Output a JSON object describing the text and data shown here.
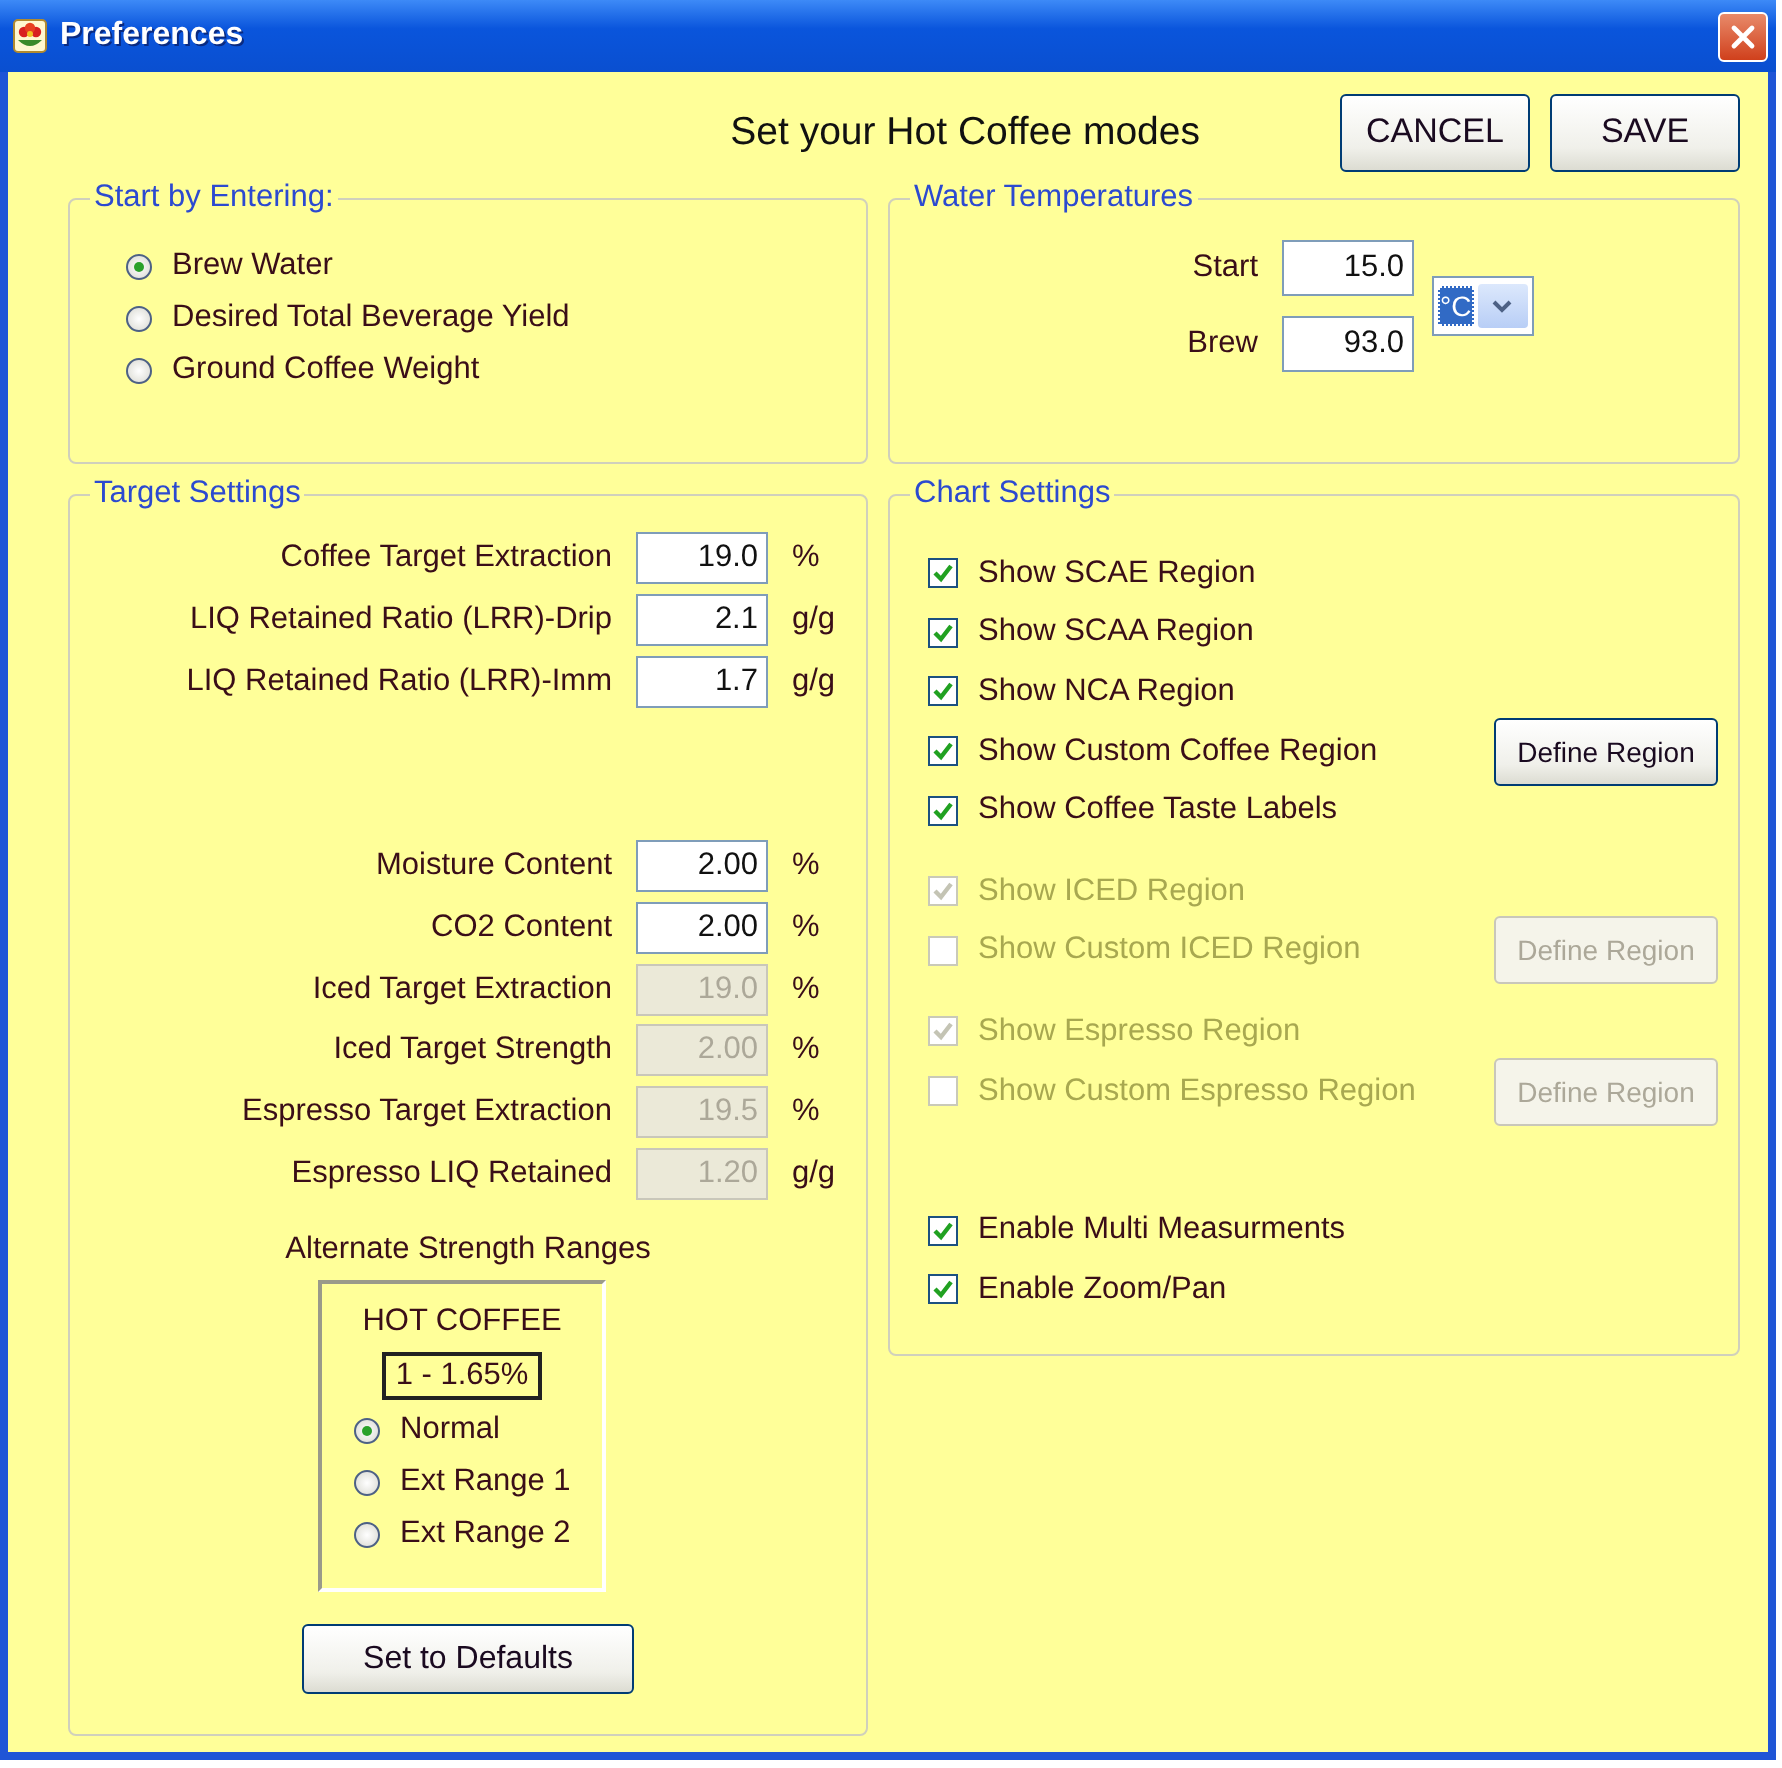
{
  "window": {
    "title": "Preferences"
  },
  "header": {
    "title": "Set your Hot Coffee modes",
    "buttons": [
      {
        "label": "CANCEL"
      },
      {
        "label": "SAVE"
      }
    ]
  },
  "start_by_entering": {
    "legend": "Start by Entering:",
    "options": [
      {
        "label": "Brew Water",
        "selected": true
      },
      {
        "label": "Desired Total Beverage Yield",
        "selected": false
      },
      {
        "label": "Ground Coffee Weight",
        "selected": false
      }
    ]
  },
  "water_temperatures": {
    "legend": "Water  Temperatures",
    "fields": [
      {
        "label": "Start",
        "value": "15.0"
      },
      {
        "label": "Brew",
        "value": "93.0"
      }
    ],
    "unit": {
      "value": "°C"
    }
  },
  "target_settings": {
    "legend": "Target Settings",
    "field_groups": [
      [
        {
          "label": "Coffee Target Extraction",
          "value": "19.0",
          "unit": "%",
          "disabled": false
        },
        {
          "label": "LIQ Retained Ratio (LRR)-Drip",
          "value": "2.1",
          "unit": "g/g",
          "disabled": false
        },
        {
          "label": "LIQ Retained Ratio (LRR)-Imm",
          "value": "1.7",
          "unit": "g/g",
          "disabled": false
        }
      ],
      [
        {
          "label": "Moisture Content",
          "value": "2.00",
          "unit": "%",
          "disabled": false
        },
        {
          "label": "CO2 Content",
          "value": "2.00",
          "unit": "%",
          "disabled": false
        },
        {
          "label": "Iced Target Extraction",
          "value": "19.0",
          "unit": "%",
          "disabled": true
        },
        {
          "label": "Iced Target Strength",
          "value": "2.00",
          "unit": "%",
          "disabled": true
        },
        {
          "label": "Espresso Target Extraction",
          "value": "19.5",
          "unit": "%",
          "disabled": true
        },
        {
          "label": "Espresso LIQ Retained",
          "value": "1.20",
          "unit": "g/g",
          "disabled": true
        }
      ]
    ],
    "alternate_strength": {
      "label": "Alternate Strength Ranges",
      "title": "HOT COFFEE",
      "range": "1 - 1.65%",
      "options": [
        {
          "label": "Normal",
          "selected": true
        },
        {
          "label": "Ext Range 1",
          "selected": false
        },
        {
          "label": "Ext Range 2",
          "selected": false
        }
      ]
    },
    "defaults_button": {
      "label": "Set to Defaults"
    }
  },
  "chart_settings": {
    "legend": "Chart Settings",
    "sections": [
      [
        {
          "label": "Show SCAE Region",
          "checked": true,
          "disabled": false
        },
        {
          "label": "Show SCAA Region",
          "checked": true,
          "disabled": false
        },
        {
          "label": "Show NCA Region",
          "checked": true,
          "disabled": false
        },
        {
          "label": "Show Custom Coffee Region",
          "checked": true,
          "disabled": false,
          "button": {
            "label": "Define Region",
            "disabled": false
          }
        },
        {
          "label": "Show Coffee Taste Labels",
          "checked": true,
          "disabled": false
        }
      ],
      [
        {
          "label": "Show ICED Region",
          "checked": true,
          "disabled": true
        },
        {
          "label": "Show Custom ICED Region",
          "checked": false,
          "disabled": true,
          "button": {
            "label": "Define Region",
            "disabled": true
          }
        }
      ],
      [
        {
          "label": "Show Espresso Region",
          "checked": true,
          "disabled": true
        },
        {
          "label": "Show Custom Espresso Region",
          "checked": false,
          "disabled": true,
          "button": {
            "label": "Define Region",
            "disabled": true
          }
        }
      ],
      [
        {
          "label": "Enable Multi Measurments",
          "checked": true,
          "disabled": false
        },
        {
          "label": "Enable Zoom/Pan",
          "checked": true,
          "disabled": false
        }
      ]
    ]
  }
}
